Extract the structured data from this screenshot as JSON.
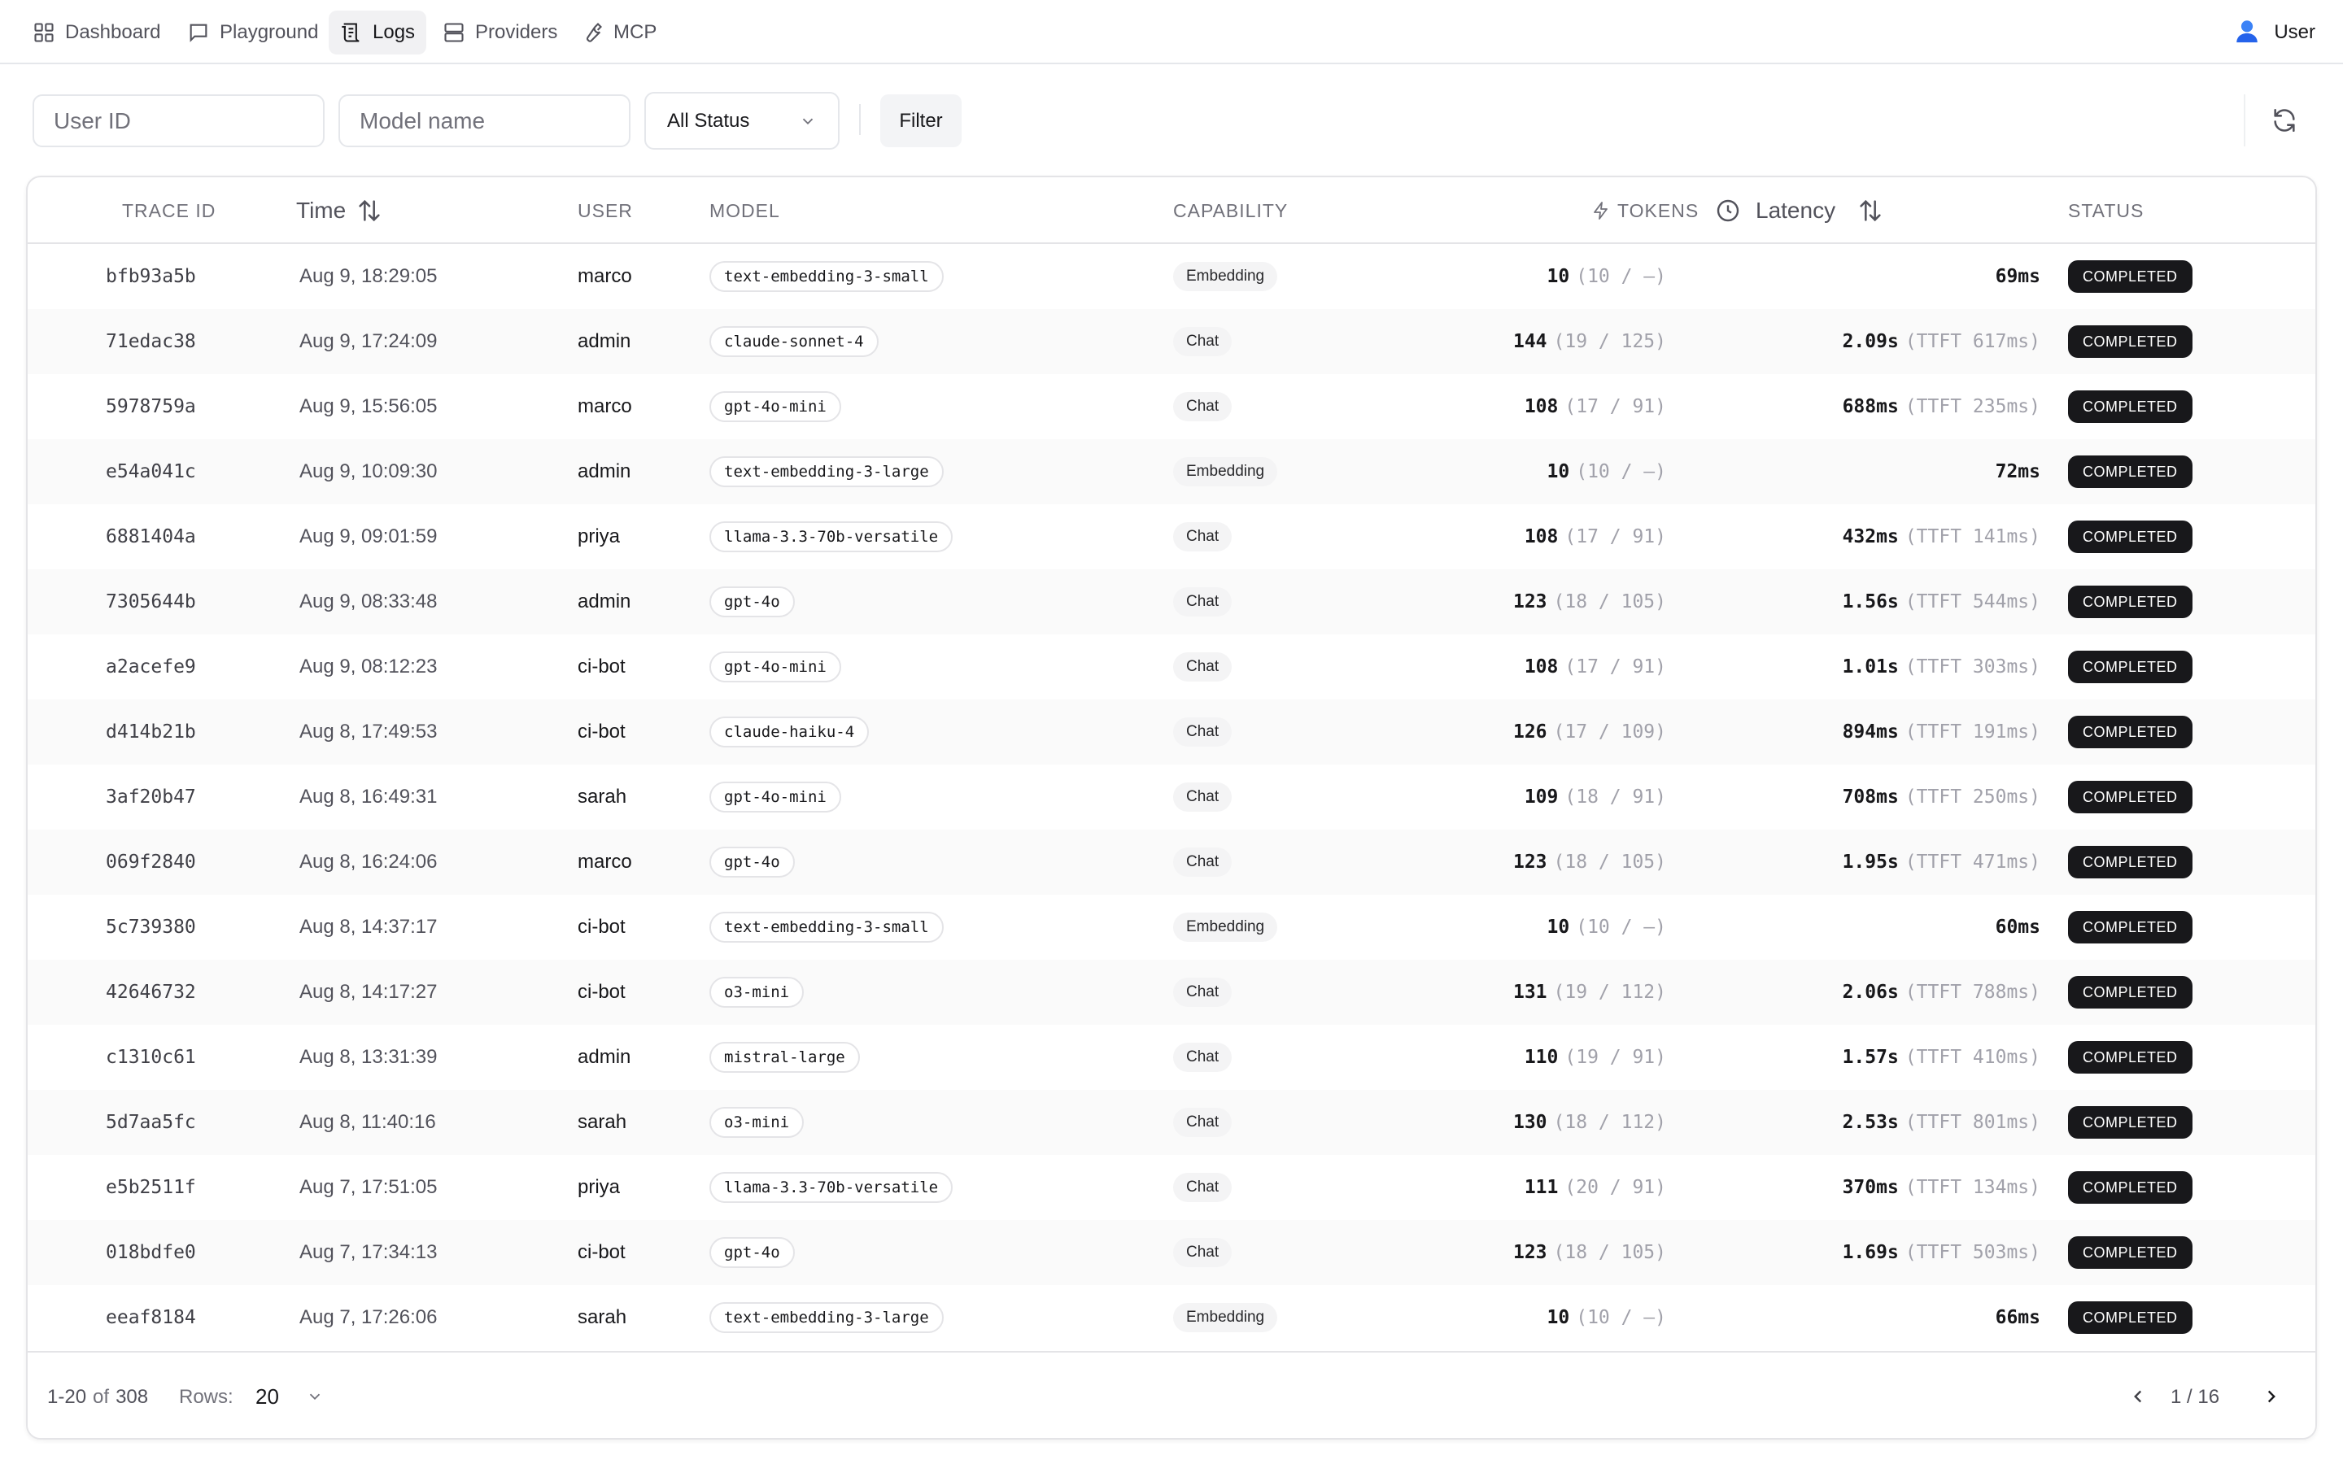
{
  "nav": {
    "items": [
      {
        "label": "Dashboard",
        "icon": "dashboard-grid-icon",
        "active": false
      },
      {
        "label": "Playground",
        "icon": "chat-bubble-icon",
        "active": false
      },
      {
        "label": "Logs",
        "icon": "logs-icon",
        "active": true
      },
      {
        "label": "Providers",
        "icon": "server-icon",
        "active": false
      },
      {
        "label": "MCP",
        "icon": "wrench-icon",
        "active": false
      }
    ],
    "user_label": "User",
    "user_icon": "user-avatar-icon"
  },
  "filters": {
    "user_id_placeholder": "User ID",
    "model_placeholder": "Model name",
    "status_value": "All Status",
    "filter_label": "Filter",
    "refresh_icon": "refresh-icon"
  },
  "table": {
    "headers": {
      "trace_id": "TRACE ID",
      "time": "Time",
      "user": "USER",
      "model": "MODEL",
      "capability": "CAPABILITY",
      "tokens": "TOKENS",
      "latency": "Latency",
      "status": "STATUS"
    },
    "rows": [
      {
        "trace_id": "bfb93a5b",
        "time": "Aug 9, 18:29:05",
        "user": "marco",
        "model": "text-embedding-3-small",
        "capability": "Embedding",
        "tokens_total": "10",
        "tokens_detail": "(10 / —)",
        "latency": "69ms",
        "ttft": "",
        "status": "COMPLETED"
      },
      {
        "trace_id": "71edac38",
        "time": "Aug 9, 17:24:09",
        "user": "admin",
        "model": "claude-sonnet-4",
        "capability": "Chat",
        "tokens_total": "144",
        "tokens_detail": "(19 / 125)",
        "latency": "2.09s",
        "ttft": "(TTFT 617ms)",
        "status": "COMPLETED"
      },
      {
        "trace_id": "5978759a",
        "time": "Aug 9, 15:56:05",
        "user": "marco",
        "model": "gpt-4o-mini",
        "capability": "Chat",
        "tokens_total": "108",
        "tokens_detail": "(17 / 91)",
        "latency": "688ms",
        "ttft": "(TTFT 235ms)",
        "status": "COMPLETED"
      },
      {
        "trace_id": "e54a041c",
        "time": "Aug 9, 10:09:30",
        "user": "admin",
        "model": "text-embedding-3-large",
        "capability": "Embedding",
        "tokens_total": "10",
        "tokens_detail": "(10 / —)",
        "latency": "72ms",
        "ttft": "",
        "status": "COMPLETED"
      },
      {
        "trace_id": "6881404a",
        "time": "Aug 9, 09:01:59",
        "user": "priya",
        "model": "llama-3.3-70b-versatile",
        "capability": "Chat",
        "tokens_total": "108",
        "tokens_detail": "(17 / 91)",
        "latency": "432ms",
        "ttft": "(TTFT 141ms)",
        "status": "COMPLETED"
      },
      {
        "trace_id": "7305644b",
        "time": "Aug 9, 08:33:48",
        "user": "admin",
        "model": "gpt-4o",
        "capability": "Chat",
        "tokens_total": "123",
        "tokens_detail": "(18 / 105)",
        "latency": "1.56s",
        "ttft": "(TTFT 544ms)",
        "status": "COMPLETED"
      },
      {
        "trace_id": "a2acefe9",
        "time": "Aug 9, 08:12:23",
        "user": "ci-bot",
        "model": "gpt-4o-mini",
        "capability": "Chat",
        "tokens_total": "108",
        "tokens_detail": "(17 / 91)",
        "latency": "1.01s",
        "ttft": "(TTFT 303ms)",
        "status": "COMPLETED"
      },
      {
        "trace_id": "d414b21b",
        "time": "Aug 8, 17:49:53",
        "user": "ci-bot",
        "model": "claude-haiku-4",
        "capability": "Chat",
        "tokens_total": "126",
        "tokens_detail": "(17 / 109)",
        "latency": "894ms",
        "ttft": "(TTFT 191ms)",
        "status": "COMPLETED"
      },
      {
        "trace_id": "3af20b47",
        "time": "Aug 8, 16:49:31",
        "user": "sarah",
        "model": "gpt-4o-mini",
        "capability": "Chat",
        "tokens_total": "109",
        "tokens_detail": "(18 / 91)",
        "latency": "708ms",
        "ttft": "(TTFT 250ms)",
        "status": "COMPLETED"
      },
      {
        "trace_id": "069f2840",
        "time": "Aug 8, 16:24:06",
        "user": "marco",
        "model": "gpt-4o",
        "capability": "Chat",
        "tokens_total": "123",
        "tokens_detail": "(18 / 105)",
        "latency": "1.95s",
        "ttft": "(TTFT 471ms)",
        "status": "COMPLETED"
      },
      {
        "trace_id": "5c739380",
        "time": "Aug 8, 14:37:17",
        "user": "ci-bot",
        "model": "text-embedding-3-small",
        "capability": "Embedding",
        "tokens_total": "10",
        "tokens_detail": "(10 / —)",
        "latency": "60ms",
        "ttft": "",
        "status": "COMPLETED"
      },
      {
        "trace_id": "42646732",
        "time": "Aug 8, 14:17:27",
        "user": "ci-bot",
        "model": "o3-mini",
        "capability": "Chat",
        "tokens_total": "131",
        "tokens_detail": "(19 / 112)",
        "latency": "2.06s",
        "ttft": "(TTFT 788ms)",
        "status": "COMPLETED"
      },
      {
        "trace_id": "c1310c61",
        "time": "Aug 8, 13:31:39",
        "user": "admin",
        "model": "mistral-large",
        "capability": "Chat",
        "tokens_total": "110",
        "tokens_detail": "(19 / 91)",
        "latency": "1.57s",
        "ttft": "(TTFT 410ms)",
        "status": "COMPLETED"
      },
      {
        "trace_id": "5d7aa5fc",
        "time": "Aug 8, 11:40:16",
        "user": "sarah",
        "model": "o3-mini",
        "capability": "Chat",
        "tokens_total": "130",
        "tokens_detail": "(18 / 112)",
        "latency": "2.53s",
        "ttft": "(TTFT 801ms)",
        "status": "COMPLETED"
      },
      {
        "trace_id": "e5b2511f",
        "time": "Aug 7, 17:51:05",
        "user": "priya",
        "model": "llama-3.3-70b-versatile",
        "capability": "Chat",
        "tokens_total": "111",
        "tokens_detail": "(20 / 91)",
        "latency": "370ms",
        "ttft": "(TTFT 134ms)",
        "status": "COMPLETED"
      },
      {
        "trace_id": "018bdfe0",
        "time": "Aug 7, 17:34:13",
        "user": "ci-bot",
        "model": "gpt-4o",
        "capability": "Chat",
        "tokens_total": "123",
        "tokens_detail": "(18 / 105)",
        "latency": "1.69s",
        "ttft": "(TTFT 503ms)",
        "status": "COMPLETED"
      },
      {
        "trace_id": "eeaf8184",
        "time": "Aug 7, 17:26:06",
        "user": "sarah",
        "model": "text-embedding-3-large",
        "capability": "Embedding",
        "tokens_total": "10",
        "tokens_detail": "(10 / —)",
        "latency": "66ms",
        "ttft": "",
        "status": "COMPLETED"
      }
    ]
  },
  "footer": {
    "range_text": "1-20",
    "of_text": "of",
    "total": "308",
    "rows_label": "Rows:",
    "rows_value": "20",
    "page_text": "1 / 16"
  },
  "colors": {
    "status_completed_bg": "#18181b",
    "accent_text": "#18181b",
    "muted_text": "#71717a",
    "border": "#e4e4e7"
  }
}
